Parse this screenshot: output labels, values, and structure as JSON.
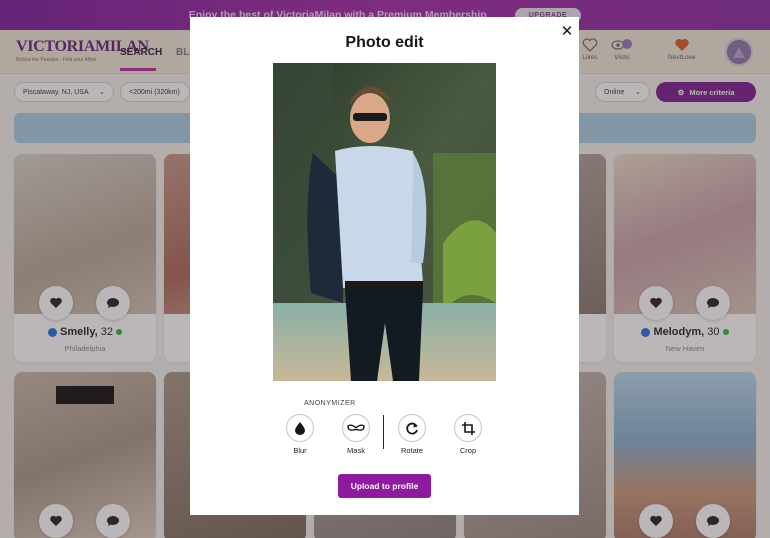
{
  "promo": {
    "text": "Enjoy the best of VictoriaMilan with a Premium Membership",
    "button": "UPGRADE"
  },
  "header": {
    "logo": "VICTORIAMILAN",
    "tagline": "Before the Passion - Find your Affair",
    "nav_search": "SEARCH",
    "nav_blog": "BLO",
    "likes": "Likes",
    "visits": "Visits",
    "visits_count": "2",
    "nextlove": "NextLove"
  },
  "filters": {
    "location": "Piscataway, NJ, USA",
    "distance": "<200mi (320km)",
    "status": "Online",
    "more_criteria": "More criteria"
  },
  "cards": [
    {
      "name": "Smelly,",
      "age": "32",
      "city": "Philadelphia"
    },
    {
      "name": "Melodym,",
      "age": "30",
      "city": "New Haven"
    }
  ],
  "modal": {
    "title": "Photo edit",
    "anonymizer_label": "ANONYMIZER",
    "tools": [
      {
        "label": "Blur"
      },
      {
        "label": "Mask"
      },
      {
        "label": "Rotate"
      },
      {
        "label": "Crop"
      }
    ],
    "upload_button": "Upload to profile",
    "close": "✕"
  },
  "colors": {
    "brand_purple": "#8e1aa0",
    "online_green": "#2fb54a",
    "verified_blue": "#2a6fd6"
  }
}
